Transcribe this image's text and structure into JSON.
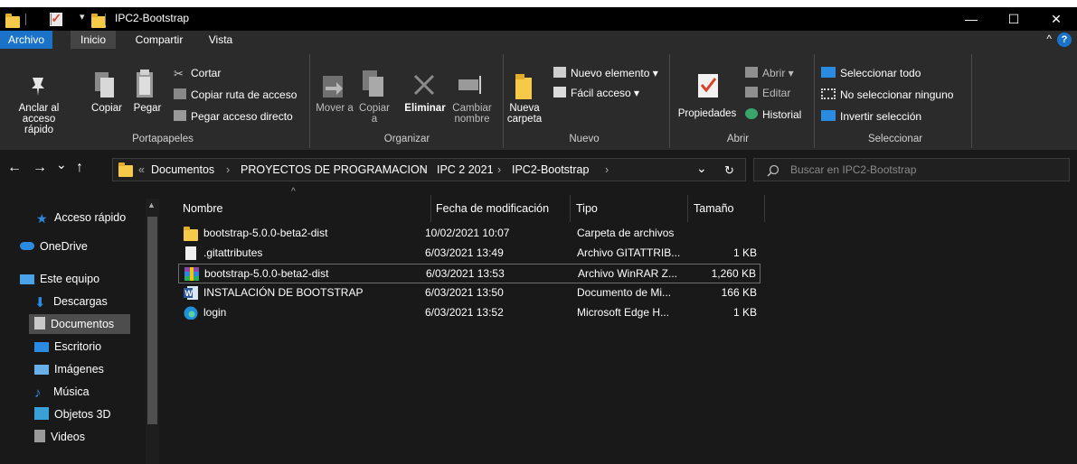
{
  "window": {
    "title": "IPC2-Bootstrap"
  },
  "controls": {
    "minimize": "—",
    "maximize": "☐",
    "close": "✕"
  },
  "menu": {
    "tabs": [
      "Archivo",
      "Inicio",
      "Compartir",
      "Vista"
    ],
    "collapse": "^",
    "help": "?"
  },
  "ribbon": {
    "portapapeles": {
      "label": "Portapapeles",
      "pin": "Anclar al acceso rápido",
      "copy": "Copiar",
      "paste": "Pegar",
      "cut": "Cortar",
      "copy_path": "Copiar ruta de acceso",
      "paste_shortcut": "Pegar acceso directo"
    },
    "organizar": {
      "label": "Organizar",
      "move_to": "Mover a",
      "copy_to": "Copiar a",
      "delete": "Eliminar",
      "rename": "Cambiar nombre"
    },
    "nuevo": {
      "label": "Nuevo",
      "new_folder": "Nueva carpeta",
      "new_item": "Nuevo elemento ▾",
      "easy_access": "Fácil acceso ▾"
    },
    "abrir": {
      "label": "Abrir",
      "properties": "Propiedades",
      "open": "Abrir ▾",
      "edit": "Editar",
      "history": "Historial"
    },
    "seleccionar": {
      "label": "Seleccionar",
      "select_all": "Seleccionar todo",
      "select_none": "No seleccionar ninguno",
      "invert": "Invertir selección"
    }
  },
  "address": {
    "back": "←",
    "forward": "→",
    "recent": "⌄",
    "up": "↑",
    "overflow": "«",
    "crumbs": [
      "Documentos",
      "PROYECTOS DE PROGRAMACION",
      "IPC 2 2021",
      "IPC2-Bootstrap"
    ],
    "separator": "›",
    "dropdown": "⌄",
    "refresh": "↻",
    "search_placeholder": "Buscar en IPC2-Bootstrap"
  },
  "nav": [
    {
      "label": "Acceso rápido"
    },
    {
      "label": "OneDrive"
    },
    {
      "label": "Este equipo"
    },
    {
      "label": "Descargas"
    },
    {
      "label": "Documentos"
    },
    {
      "label": "Escritorio"
    },
    {
      "label": "Imágenes"
    },
    {
      "label": "Música"
    },
    {
      "label": "Objetos 3D"
    },
    {
      "label": "Videos"
    }
  ],
  "columns": {
    "name": "Nombre",
    "modified": "Fecha de modificación",
    "type": "Tipo",
    "size": "Tamaño"
  },
  "files": [
    {
      "name": "bootstrap-5.0.0-beta2-dist",
      "modified": "10/02/2021 10:07",
      "type": "Carpeta de archivos",
      "size": ""
    },
    {
      "name": ".gitattributes",
      "modified": "6/03/2021 13:49",
      "type": "Archivo GITATTRIB...",
      "size": "1 KB"
    },
    {
      "name": "bootstrap-5.0.0-beta2-dist",
      "modified": "6/03/2021 13:53",
      "type": "Archivo WinRAR Z...",
      "size": "1,260 KB"
    },
    {
      "name": "INSTALACIÓN DE BOOTSTRAP",
      "modified": "6/03/2021 13:50",
      "type": "Documento de Mi...",
      "size": "166 KB"
    },
    {
      "name": "login",
      "modified": "6/03/2021 13:52",
      "type": "Microsoft Edge H...",
      "size": "1 KB"
    }
  ],
  "colors": {
    "accent": "#1a73c8",
    "folder": "#f7c948",
    "ribbon_bg": "#2b2b2b",
    "window_bg": "#191919"
  }
}
